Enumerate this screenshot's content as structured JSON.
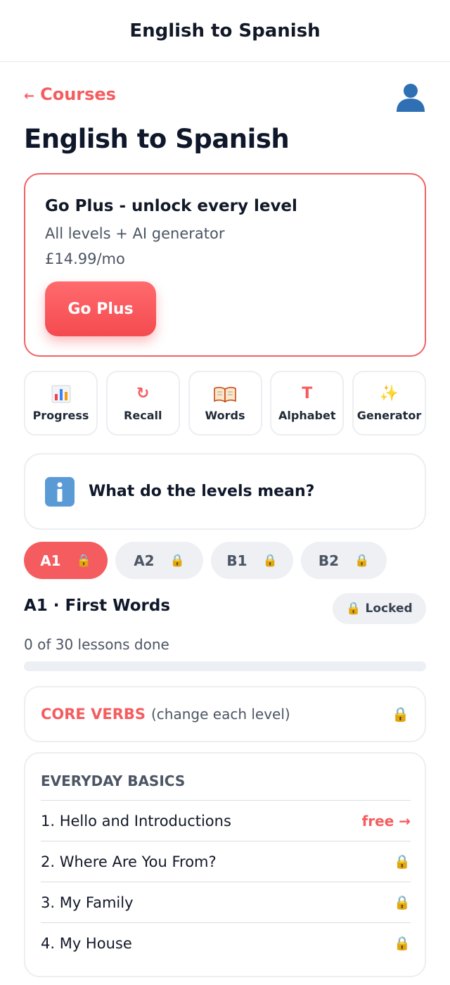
{
  "header": {
    "title": "English to Spanish"
  },
  "nav": {
    "back_arrow": "←",
    "back_label": "Courses",
    "profile_icon": "user-icon"
  },
  "page": {
    "title": "English to Spanish"
  },
  "plus_card": {
    "title": "Go Plus - unlock every level",
    "subtitle": "All levels + AI generator",
    "price": "£14.99/mo",
    "button_label": "Go Plus"
  },
  "tools": [
    {
      "label": "Progress",
      "icon": "bar-chart-icon"
    },
    {
      "label": "Recall",
      "icon": "refresh-icon",
      "glyph": "↻"
    },
    {
      "label": "Words",
      "icon": "open-book-icon"
    },
    {
      "label": "Alphabet",
      "icon": "letter-t-icon",
      "glyph": "T"
    },
    {
      "label": "Generator",
      "icon": "sparkles-icon",
      "glyph": "✨"
    }
  ],
  "levels_info": {
    "label": "What do the levels mean?",
    "icon": "info-icon",
    "glyph": "i"
  },
  "level_tabs": [
    {
      "label": "A1",
      "active": true,
      "locked": true
    },
    {
      "label": "A2",
      "active": false,
      "locked": true
    },
    {
      "label": "B1",
      "active": false,
      "locked": true
    },
    {
      "label": "B2",
      "active": false,
      "locked": true
    }
  ],
  "lock_glyph": "🔒",
  "level": {
    "heading": "A1 · First Words",
    "status": "Locked",
    "progress_text": "0 of 30 lessons done",
    "progress_fraction": 0
  },
  "core_verbs": {
    "title": "CORE VERBS",
    "note": "(change each level)"
  },
  "everyday_basics": {
    "title": "EVERYDAY BASICS",
    "lessons": [
      {
        "title": "1. Hello and Introductions",
        "status": "free →",
        "free": true
      },
      {
        "title": "2. Where Are You From?",
        "free": false
      },
      {
        "title": "3. My Family",
        "free": false
      },
      {
        "title": "4. My House",
        "free": false
      }
    ]
  },
  "colors": {
    "accent": "#f55c5f",
    "text": "#0f172a",
    "muted": "#4b5563",
    "border": "#eceef2"
  }
}
